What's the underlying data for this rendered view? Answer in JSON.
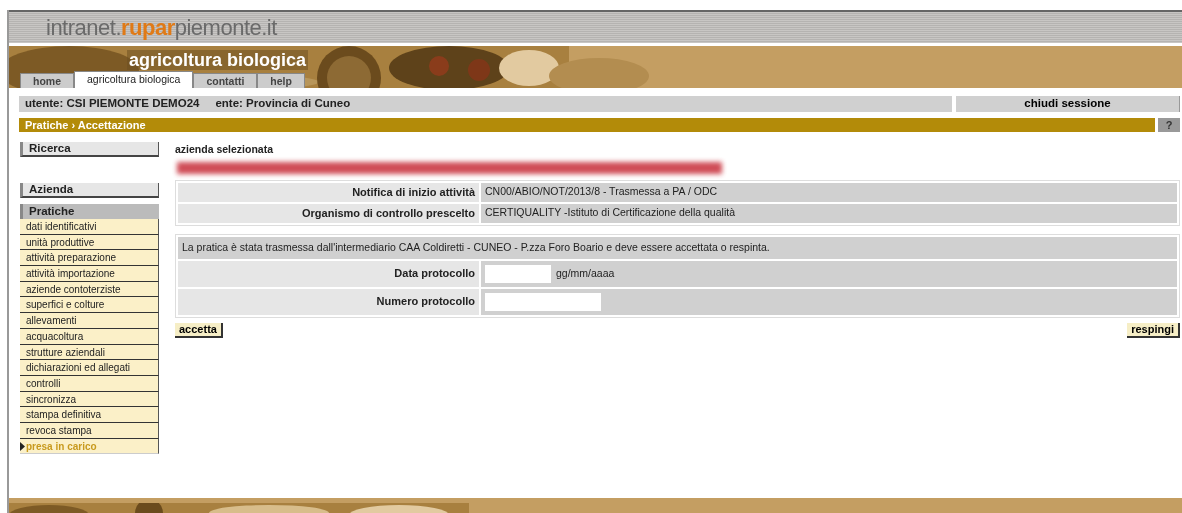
{
  "header": {
    "logo_prefix": "intranet.",
    "logo_brand": "rupar",
    "logo_suffix": "piemonte.it"
  },
  "banner": {
    "title": "agricoltura biologica"
  },
  "tabs": [
    {
      "label": "home",
      "selected": false
    },
    {
      "label": "agricoltura biologica",
      "selected": true
    },
    {
      "label": "contatti",
      "selected": false
    },
    {
      "label": "help",
      "selected": false
    }
  ],
  "user_bar": {
    "user": "utente: CSI PIEMONTE DEMO24",
    "ente": "ente: Provincia di Cuneo",
    "logout": "chiudi sessione"
  },
  "breadcrumb": {
    "text": "Pratiche › Accettazione",
    "help": "?"
  },
  "sidebar": {
    "search": "Ricerca",
    "company": "Azienda",
    "section": "Pratiche",
    "items": [
      {
        "label": "dati identificativi",
        "selected": false
      },
      {
        "label": "unità produttive",
        "selected": false
      },
      {
        "label": "attività preparazione",
        "selected": false
      },
      {
        "label": "attività importazione",
        "selected": false
      },
      {
        "label": "aziende contoterziste",
        "selected": false
      },
      {
        "label": "superfici e colture",
        "selected": false
      },
      {
        "label": "allevamenti",
        "selected": false
      },
      {
        "label": "acquacoltura",
        "selected": false
      },
      {
        "label": "strutture aziendali",
        "selected": false
      },
      {
        "label": "dichiarazioni ed allegati",
        "selected": false
      },
      {
        "label": "controlli",
        "selected": false
      },
      {
        "label": "sincronizza",
        "selected": false
      },
      {
        "label": "stampa definitiva",
        "selected": false
      },
      {
        "label": "revoca stampa",
        "selected": false
      },
      {
        "label": "presa in carico",
        "selected": true
      }
    ]
  },
  "content": {
    "company_heading": "azienda selezionata",
    "details": [
      {
        "label": "Notifica di inizio attività",
        "value": "CN00/ABIO/NOT/2013/8 - Trasmessa a PA / ODC"
      },
      {
        "label": "Organismo di controllo prescelto",
        "value": "CERTIQUALITY -Istituto di Certificazione della qualità"
      }
    ],
    "message": "La pratica è stata trasmessa dall'intermediario CAA Coldiretti - CUNEO - P.zza Foro Boario e deve essere accettata o respinta.",
    "fields": [
      {
        "label": "Data protocollo",
        "hint": "gg/mm/aaaa",
        "kind": "short"
      },
      {
        "label": "Numero protocollo",
        "kind": "long"
      }
    ],
    "accept": "accetta",
    "reject": "respingi"
  }
}
